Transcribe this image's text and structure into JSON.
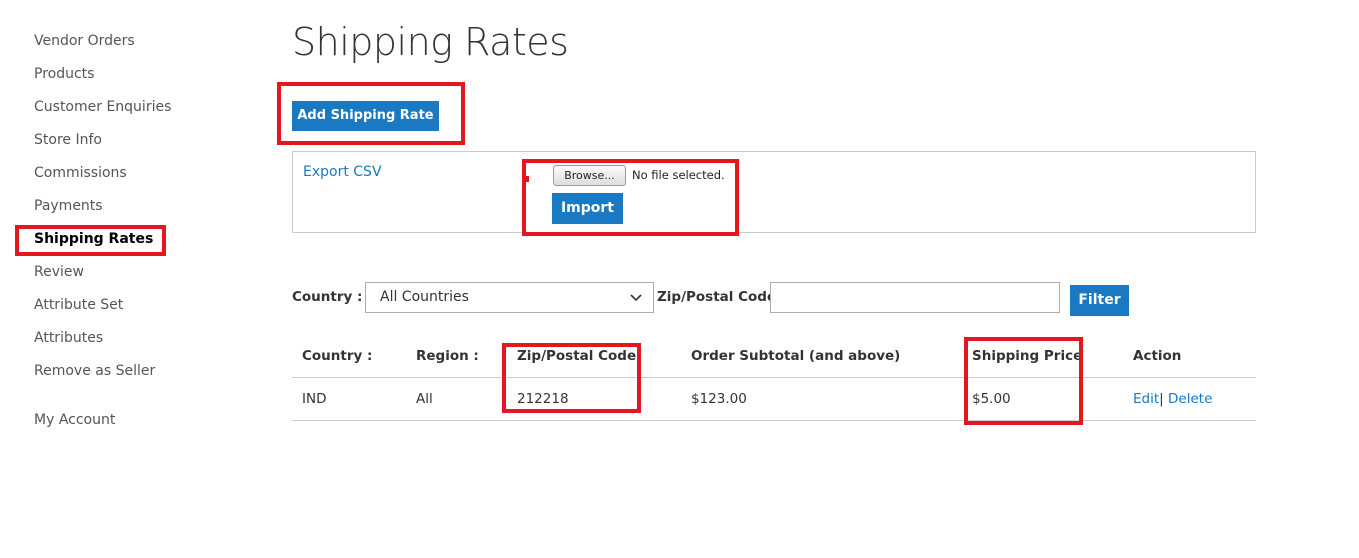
{
  "sidebar": {
    "items": [
      {
        "label": "Vendor Orders"
      },
      {
        "label": "Products"
      },
      {
        "label": "Customer Enquiries"
      },
      {
        "label": "Store Info"
      },
      {
        "label": "Commissions"
      },
      {
        "label": "Payments"
      },
      {
        "label": "Shipping Rates",
        "active": true
      },
      {
        "label": "Review"
      },
      {
        "label": "Attribute Set"
      },
      {
        "label": "Attributes"
      },
      {
        "label": "Remove as Seller"
      }
    ],
    "account_label": "My Account"
  },
  "page": {
    "title": "Shipping Rates",
    "add_button": "Add Shipping Rate"
  },
  "import_panel": {
    "export_link": "Export CSV",
    "browse_label": "Browse...",
    "file_status": "No file selected.",
    "import_button": "Import"
  },
  "filters": {
    "country_label": "Country : :",
    "country_selected": "All Countries",
    "zip_label": "Zip/Postal Code:",
    "zip_value": "",
    "filter_button": "Filter"
  },
  "table": {
    "columns": [
      "Country :",
      "Region :",
      "Zip/Postal Code",
      "Order Subtotal (and above)",
      "Shipping Price",
      "Action"
    ],
    "rows": [
      {
        "country": "IND",
        "region": "All",
        "zip": "212218",
        "subtotal": "$123.00",
        "price": "$5.00",
        "edit": "Edit",
        "separator": "|",
        "delete": "Delete"
      }
    ]
  },
  "colors": {
    "primary": "#1979c3",
    "highlight": "#e4161f",
    "border": "#cccccc"
  },
  "icons": {
    "select_chevron": "chevron-down-icon"
  }
}
